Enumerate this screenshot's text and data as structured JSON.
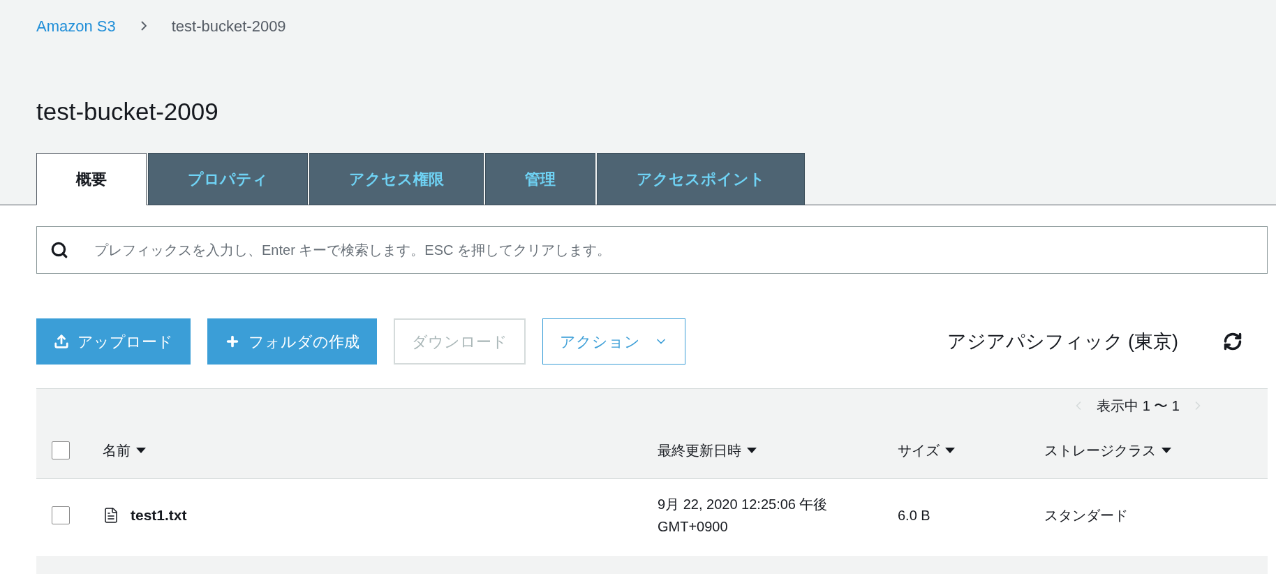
{
  "breadcrumb": [
    {
      "label": "Amazon S3",
      "kind": "link"
    },
    {
      "label": "test-bucket-2009",
      "kind": "current"
    }
  ],
  "title": "test-bucket-2009",
  "tabs": [
    {
      "label": "概要",
      "selected": true
    },
    {
      "label": "プロパティ",
      "selected": false
    },
    {
      "label": "アクセス権限",
      "selected": false
    },
    {
      "label": "管理",
      "selected": false
    },
    {
      "label": "アクセスポイント",
      "selected": false
    }
  ],
  "search": {
    "placeholder": "プレフィックスを入力し、Enter キーで検索します。ESC を押してクリアします。"
  },
  "buttons": [
    {
      "label": "アップロード",
      "kind": "upload",
      "disabled": false
    },
    {
      "label": "フォルダの作成",
      "kind": "create",
      "disabled": false
    },
    {
      "label": "ダウンロード",
      "kind": "plain",
      "disabled": true
    },
    {
      "label": "アクション",
      "kind": "menu",
      "disabled": false
    }
  ],
  "region": "アジアパシフィック (東京)",
  "pagination": "表示中 1 〜 1",
  "table": {
    "columns": [
      "名前",
      "最終更新日時",
      "サイズ",
      "ストレージクラス"
    ],
    "header_checked": false,
    "rows": [
      {
        "name": "test1.txt",
        "modified": "9月 22, 2020 12:25:06 午後 GMT+0900",
        "size": "6.0 B",
        "storage_class": "スタンダード",
        "checked": false
      }
    ]
  }
}
